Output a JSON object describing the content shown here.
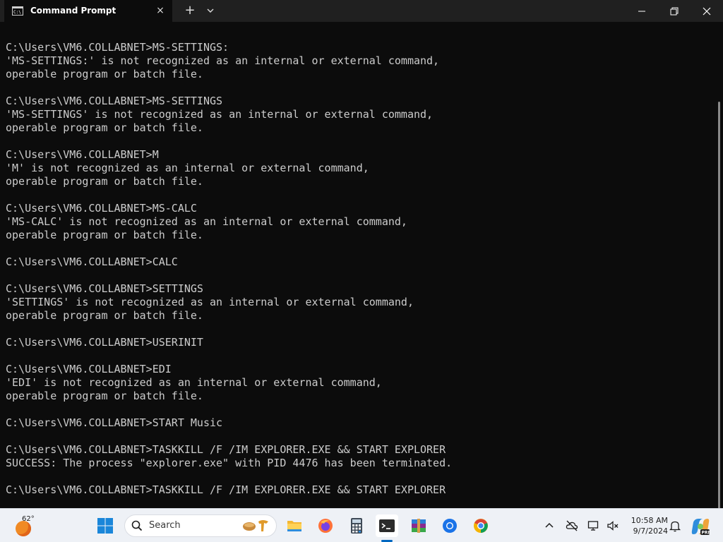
{
  "window": {
    "tab_title": "Command Prompt",
    "tab_icon": "cmd-icon",
    "close_tab": "×",
    "new_tab": "+"
  },
  "terminal": {
    "lines": [
      "C:\\Users\\VM6.COLLABNET>MS-SETTINGS:",
      "'MS-SETTINGS:' is not recognized as an internal or external command,",
      "operable program or batch file.",
      "",
      "C:\\Users\\VM6.COLLABNET>MS-SETTINGS",
      "'MS-SETTINGS' is not recognized as an internal or external command,",
      "operable program or batch file.",
      "",
      "C:\\Users\\VM6.COLLABNET>M",
      "'M' is not recognized as an internal or external command,",
      "operable program or batch file.",
      "",
      "C:\\Users\\VM6.COLLABNET>MS-CALC",
      "'MS-CALC' is not recognized as an internal or external command,",
      "operable program or batch file.",
      "",
      "C:\\Users\\VM6.COLLABNET>CALC",
      "",
      "C:\\Users\\VM6.COLLABNET>SETTINGS",
      "'SETTINGS' is not recognized as an internal or external command,",
      "operable program or batch file.",
      "",
      "C:\\Users\\VM6.COLLABNET>USERINIT",
      "",
      "C:\\Users\\VM6.COLLABNET>EDI",
      "'EDI' is not recognized as an internal or external command,",
      "operable program or batch file.",
      "",
      "C:\\Users\\VM6.COLLABNET>START Music",
      "",
      "C:\\Users\\VM6.COLLABNET>TASKKILL /F /IM EXPLORER.EXE && START EXPLORER",
      "SUCCESS: The process \"explorer.exe\" with PID 4476 has been terminated.",
      "",
      "C:\\Users\\VM6.COLLABNET>TASKKILL /F /IM EXPLORER.EXE && START EXPLORER"
    ]
  },
  "taskbar": {
    "weather_temp": "62°",
    "search_placeholder": "Search",
    "time": "10:58 AM",
    "date": "9/7/2024",
    "pinned": [
      "start-icon",
      "file-explorer-icon",
      "firefox-icon",
      "calculator-icon",
      "terminal-icon",
      "winrar-icon",
      "chrome-icon",
      "chrome-canary-icon"
    ]
  },
  "colors": {
    "terminal_bg": "#0c0c0c",
    "terminal_text": "#cccccc",
    "titlebar_bg": "#202020",
    "taskbar_bg": "#eef1f6",
    "accent": "#0067c0"
  }
}
